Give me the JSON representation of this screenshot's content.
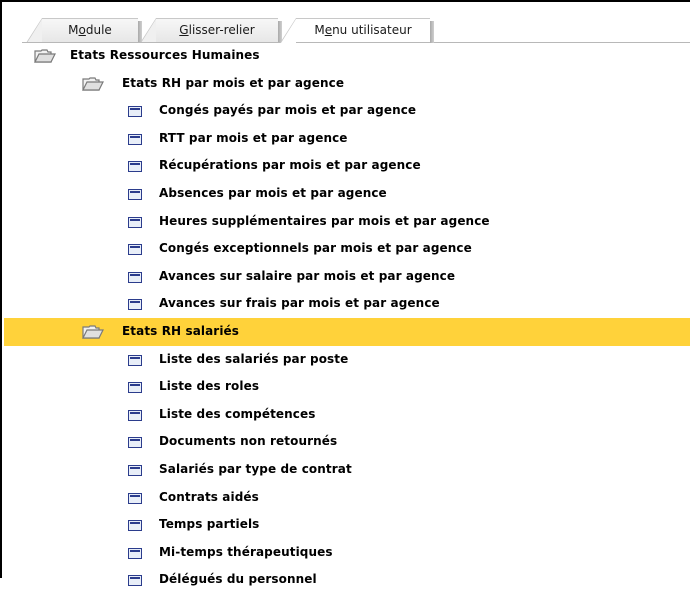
{
  "tabs": [
    {
      "label": "Module",
      "shortcut_index": 1,
      "active": false
    },
    {
      "label": "Glisser-relier",
      "shortcut_index": 0,
      "active": false
    },
    {
      "label": "Menu utilisateur",
      "shortcut_index": 1,
      "active": true
    }
  ],
  "tree": {
    "root": {
      "label": "Etats Ressources Humaines",
      "icon": "folder-open-icon"
    },
    "groups": [
      {
        "label": "Etats RH par mois et par agence",
        "icon": "folder-open-icon",
        "selected": false,
        "items": [
          "Congés payés par mois et par agence",
          "RTT par mois et par agence",
          "Récupérations par mois et par agence",
          "Absences par mois et par agence",
          "Heures supplémentaires par mois et par agence",
          "Congés exceptionnels par mois et par agence",
          "Avances sur salaire par mois et par agence",
          "Avances sur frais par mois et par agence"
        ]
      },
      {
        "label": "Etats RH salariés",
        "icon": "folder-open-icon",
        "selected": true,
        "items": [
          "Liste des salariés par poste",
          "Liste des roles",
          "Liste des compétences",
          "Documents non retournés",
          "Salariés par type de contrat",
          "Contrats aidés",
          "Temps partiels",
          "Mi-temps thérapeutiques",
          "Délégués du personnel"
        ]
      }
    ]
  },
  "colors": {
    "selection": "#ffd23a",
    "doc_icon": "#2b3c8c",
    "folder_icon": "#7a7a7a"
  }
}
